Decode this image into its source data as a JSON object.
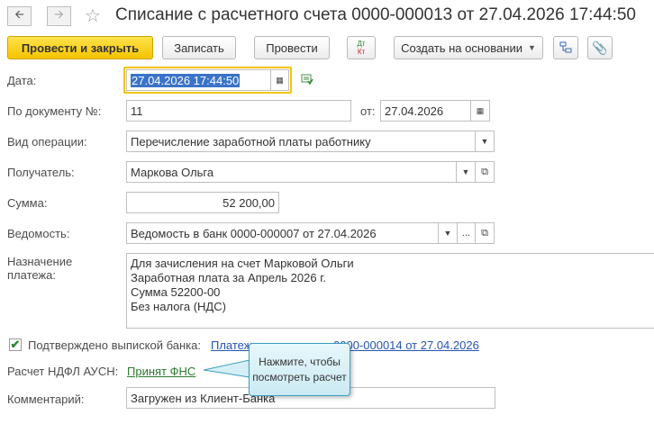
{
  "window": {
    "title": "Списание с расчетного счета 0000-000013 от 27.04.2026 17:44:50",
    "back_icon": "arrow-left-icon",
    "forward_icon": "arrow-right-icon",
    "favorite_icon": "star-icon"
  },
  "toolbar": {
    "post_close_label": "Провести и закрыть",
    "save_label": "Записать",
    "post_label": "Провести",
    "dtkt_label_top": "Дт",
    "dtkt_label_bottom": "Кт",
    "create_based_label": "Создать на основании",
    "structure_icon": "structure-icon",
    "attach_icon": "paperclip-icon"
  },
  "form": {
    "date": {
      "label": "Дата:",
      "value": "27.04.2026 17:44:50"
    },
    "doc_number": {
      "label": "По документу №:",
      "value": "11",
      "from_label": "от:",
      "from_value": "27.04.2026"
    },
    "operation": {
      "label": "Вид операции:",
      "value": "Перечисление заработной платы работнику"
    },
    "recipient": {
      "label": "Получатель:",
      "value": "Маркова Ольга"
    },
    "amount": {
      "label": "Сумма:",
      "value": "52 200,00"
    },
    "statement": {
      "label": "Ведомость:",
      "value": "Ведомость в банк 0000-000007 от 27.04.2026",
      "more": "..."
    },
    "purpose": {
      "label_line1": "Назначение",
      "label_line2": "платежа:",
      "lines": [
        "Для зачисления на счет Марковой Ольги",
        "Заработная плата за Апрель 2026 г.",
        "Сумма 52200-00",
        "Без налога (НДС)"
      ]
    },
    "confirmed": {
      "label": "Подтверждено выпиской банка:",
      "checked": true,
      "link_start": "Платеж",
      "link_end": "0000-000014 от 27.04.2026"
    },
    "ndfl": {
      "label": "Расчет НДФЛ АУСН:",
      "link": "Принят ФНС"
    },
    "comment": {
      "label": "Комментарий:",
      "value": "Загружен из Клиент-Банка"
    }
  },
  "tooltip": {
    "line1": "Нажмите, чтобы",
    "line2": "посмотреть расчет"
  },
  "colors": {
    "accent_yellow": "#f5c400",
    "selection": "#3a73c8",
    "link": "#2754b3",
    "ok_link": "#2d7a2d",
    "tooltip_border": "#39a0c0"
  }
}
